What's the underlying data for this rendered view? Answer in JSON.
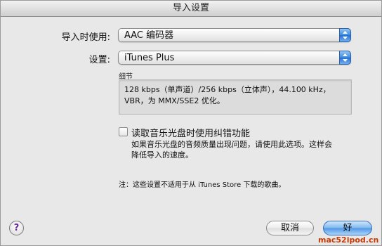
{
  "window": {
    "title": "导入设置"
  },
  "import_using": {
    "label": "导入时使用:",
    "value": "AAC 编码器"
  },
  "setting": {
    "label": "设置:",
    "value": "iTunes Plus"
  },
  "details": {
    "title": "细节",
    "text": "128 kbps（单声道）/256 kbps（立体声），44.100 kHz，VBR，为 MMX/SSE2 优化。"
  },
  "error_correction": {
    "label": "读取音乐光盘时使用纠错功能",
    "checked": false,
    "help": "如果音乐光盘的音频质量出现问题，请使用此选项。这样会降低导入的速度。"
  },
  "note": "注：这些设置不适用于从 iTunes Store 下载的歌曲。",
  "buttons": {
    "help": "?",
    "cancel": "取消",
    "ok": "好"
  },
  "watermark": "mac52ipod.cn",
  "colors": {
    "accent_blue": "#4f97e6",
    "help_purple": "#6a2a9a",
    "watermark_orange": "#c83a00"
  }
}
